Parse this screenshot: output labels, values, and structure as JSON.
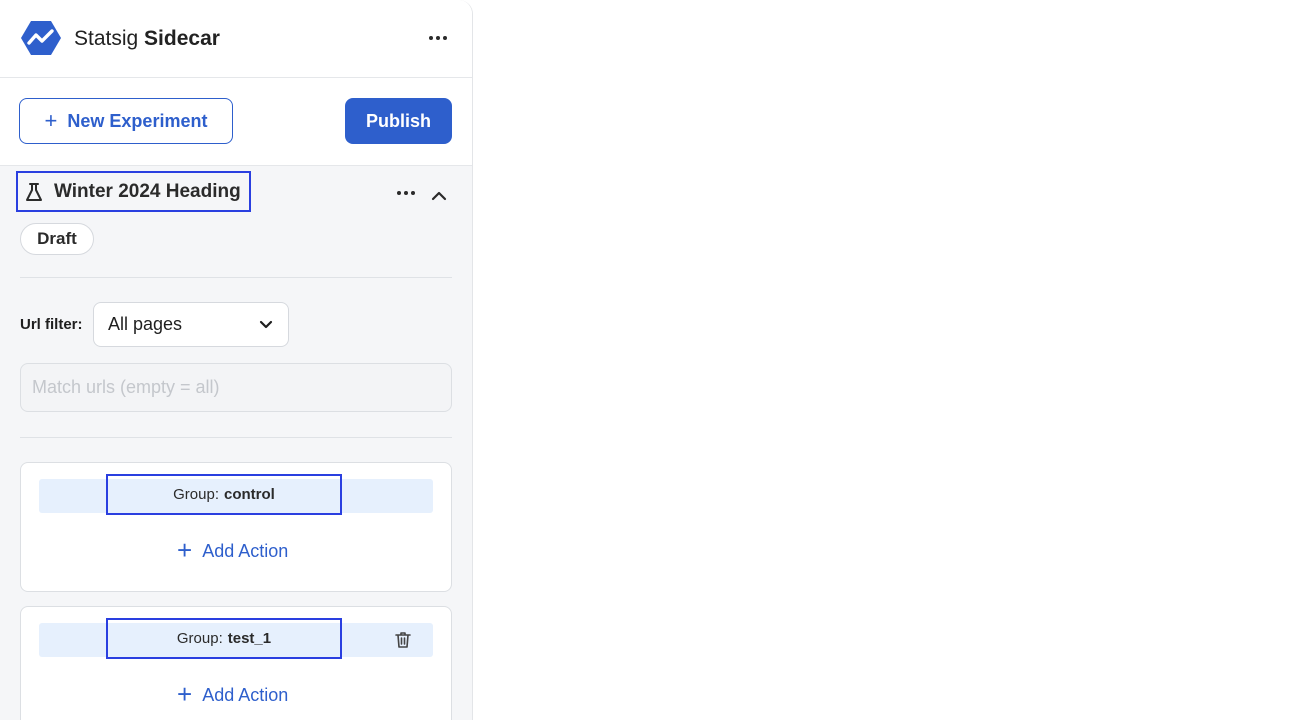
{
  "header": {
    "brand_prefix": "Statsig",
    "brand_name": "Sidecar",
    "brand_color": "#2e5fcc"
  },
  "toolbar": {
    "new_experiment_label": "New Experiment",
    "publish_label": "Publish"
  },
  "experiment": {
    "title": "Winter 2024 Heading",
    "status": "Draft",
    "url_filter_label": "Url filter:",
    "url_filter_value": "All pages",
    "match_urls_placeholder": "Match urls (empty = all)",
    "match_urls_value": ""
  },
  "groups": [
    {
      "prefix": "Group:",
      "name": "control",
      "add_action_label": "Add Action"
    },
    {
      "prefix": "Group:",
      "name": "test_1",
      "add_action_label": "Add Action"
    }
  ],
  "icons": {
    "logo": "statsig-logo-icon",
    "more": "more-horizontal-icon",
    "flask": "flask-icon",
    "collapse": "chevron-up-icon",
    "dropdown": "chevron-down-icon",
    "plus": "plus-icon",
    "trash": "trash-icon"
  }
}
